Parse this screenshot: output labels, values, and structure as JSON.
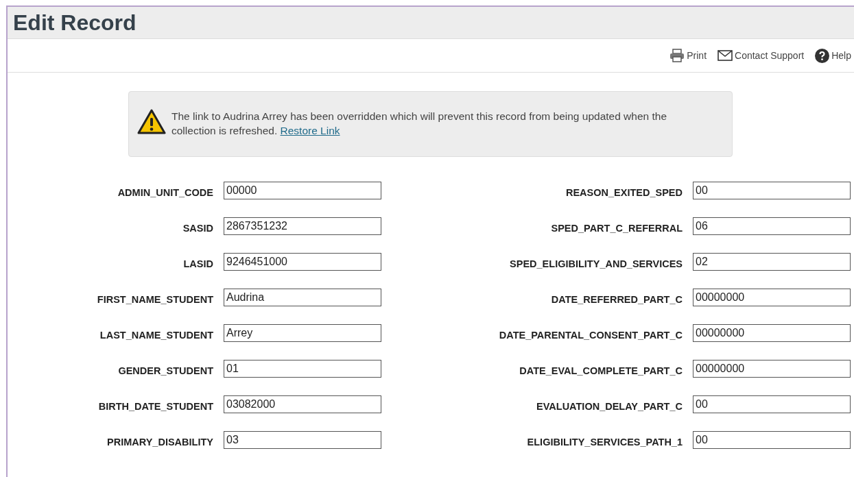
{
  "page": {
    "title": "Edit Record"
  },
  "toolbar": [
    {
      "kind": "print",
      "label": "Print"
    },
    {
      "kind": "mail",
      "label": "Contact Support"
    },
    {
      "kind": "help",
      "label": "Help"
    }
  ],
  "alert": {
    "message": "The link to Audrina Arrey has been overridden which will prevent this record from being updated when the collection is refreshed.",
    "link": "Restore Link"
  },
  "fields": [
    {
      "label": "ADMIN_UNIT_CODE",
      "value": "00000"
    },
    {
      "label": "REASON_EXITED_SPED",
      "value": "00"
    },
    {
      "label": "SASID",
      "value": "2867351232"
    },
    {
      "label": "SPED_PART_C_REFERRAL",
      "value": "06"
    },
    {
      "label": "LASID",
      "value": "9246451000"
    },
    {
      "label": "SPED_ELIGIBILITY_AND_SERVICES",
      "value": "02"
    },
    {
      "label": "FIRST_NAME_STUDENT",
      "value": "Audrina"
    },
    {
      "label": "DATE_REFERRED_PART_C",
      "value": "00000000"
    },
    {
      "label": "LAST_NAME_STUDENT",
      "value": "Arrey"
    },
    {
      "label": "DATE_PARENTAL_CONSENT_PART_C",
      "value": "00000000"
    },
    {
      "label": "GENDER_STUDENT",
      "value": "01"
    },
    {
      "label": "DATE_EVAL_COMPLETE_PART_C",
      "value": "00000000"
    },
    {
      "label": "BIRTH_DATE_STUDENT",
      "value": "03082000"
    },
    {
      "label": "EVALUATION_DELAY_PART_C",
      "value": "00"
    },
    {
      "label": "PRIMARY_DISABILITY",
      "value": "03"
    },
    {
      "label": "ELIGIBILITY_SERVICES_PATH_1",
      "value": "00"
    }
  ]
}
